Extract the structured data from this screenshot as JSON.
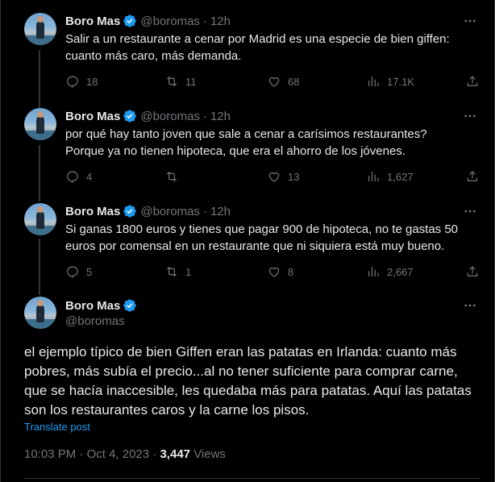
{
  "tweets": [
    {
      "name": "Boro Mas",
      "handle": "@boromas",
      "dot": "·",
      "time": "12h",
      "text": "Salir a un restaurante a cenar por Madrid es una especie de bien giffen: cuanto más caro, más demanda.",
      "replies": "18",
      "retweets": "11",
      "likes": "68",
      "views": "17.1K"
    },
    {
      "name": "Boro Mas",
      "handle": "@boromas",
      "dot": "·",
      "time": "12h",
      "text": "por qué hay tanto joven que sale a cenar a carísimos restaurantes? Porque ya no tienen hipoteca, que era el ahorro de los jóvenes.",
      "replies": "4",
      "retweets": "",
      "likes": "13",
      "views": "1,627"
    },
    {
      "name": "Boro Mas",
      "handle": "@boromas",
      "dot": "·",
      "time": "12h",
      "text": "Si ganas 1800 euros y tienes que pagar 900 de hipoteca, no te gastas 50 euros por comensal en un restaurante que ni siquiera está muy bueno.",
      "replies": "5",
      "retweets": "1",
      "likes": "8",
      "views": "2,667"
    }
  ],
  "main": {
    "name": "Boro Mas",
    "handle": "@boromas",
    "text": "el ejemplo típico de bien Giffen eran las patatas en Irlanda: cuanto más pobres, más subía el precio...al no tener suficiente para comprar carne, que se hacía inaccesible, les quedaba más para patatas. Aquí las patatas son los restaurantes caros y la carne los pisos.",
    "translate": "Translate post",
    "time": "10:03 PM",
    "dot": "·",
    "date": "Oct 4, 2023",
    "views_count": "3,447",
    "views_label": "Views"
  },
  "colors": {
    "background": "#000000",
    "text": "#e7e9ea",
    "secondary": "#71767b",
    "accent": "#1d9bf0"
  },
  "icons": [
    "verified-badge-icon",
    "more-icon",
    "reply-icon",
    "retweet-icon",
    "like-icon",
    "views-icon",
    "share-icon"
  ]
}
